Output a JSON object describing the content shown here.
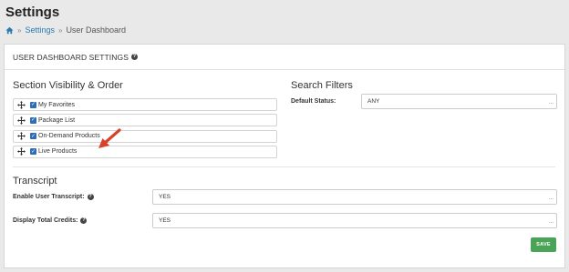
{
  "page": {
    "title": "Settings"
  },
  "breadcrumb": {
    "home_icon": "home-icon",
    "items": [
      "Settings",
      "User Dashboard"
    ]
  },
  "panel": {
    "header": "USER DASHBOARD SETTINGS"
  },
  "visibility": {
    "title": "Section Visibility & Order",
    "items": [
      {
        "label": "My Favorites",
        "checked": true
      },
      {
        "label": "Package List",
        "checked": true
      },
      {
        "label": "On-Demand Products",
        "checked": true
      },
      {
        "label": "Live Products",
        "checked": true
      }
    ]
  },
  "filters": {
    "title": "Search Filters",
    "default_status_label": "Default Status:",
    "default_status_value": "ANY"
  },
  "transcript": {
    "title": "Transcript",
    "enable_label": "Enable User Transcript:",
    "enable_value": "YES",
    "credits_label": "Display Total Credits:",
    "credits_value": "YES"
  },
  "select_ellipsis": "...",
  "actions": {
    "save_label": "SAVE"
  },
  "colors": {
    "accent_blue": "#2f6db6",
    "link_blue": "#2a7ab0",
    "save_green": "#4aa356",
    "arrow_red": "#d9412b"
  }
}
